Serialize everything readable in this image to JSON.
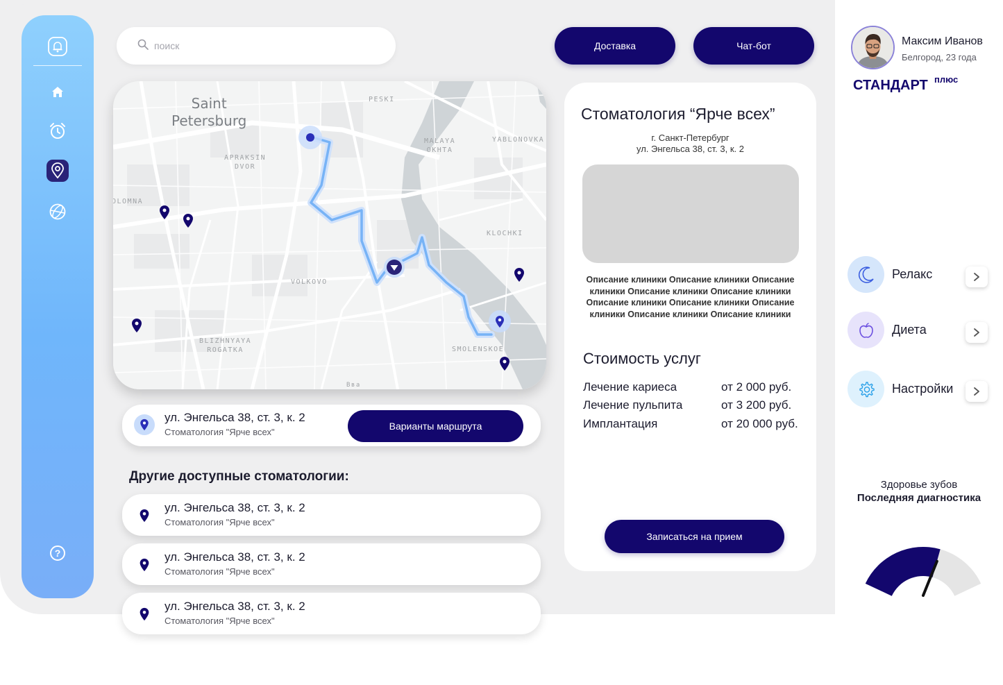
{
  "search": {
    "placeholder": "поиск"
  },
  "header": {
    "delivery_label": "Доставка",
    "chatbot_label": "Чат-бот"
  },
  "sidebar": {
    "items": [
      {
        "name": "bell-icon"
      },
      {
        "name": "home-icon"
      },
      {
        "name": "alarm-clock-icon"
      },
      {
        "name": "map-pin-icon",
        "active": true
      },
      {
        "name": "globe-icon"
      },
      {
        "name": "help-icon"
      }
    ]
  },
  "map": {
    "city": "Saint\nPetersburg",
    "labels": [
      "PESKI",
      "MALAYA\nOKHTA",
      "YABLONOVKA",
      "APRAKSIN\nDVOR",
      "OLOMNA",
      "KLOCHKI",
      "VOLKOVO",
      "BLIZHNYAYA\nROGATKA",
      "SMOLENSKOE",
      "Вва"
    ]
  },
  "selected": {
    "address": "ул. Энгельса 38, ст. 3, к. 2",
    "clinic": "Стоматология \"Ярче всех\"",
    "route_button": "Варианты маршрута"
  },
  "others": {
    "title": "Другие доступные стоматологии:",
    "items": [
      {
        "address": "ул. Энгельса 38, ст. 3, к. 2",
        "clinic": "Стоматология \"Ярче всех\""
      },
      {
        "address": "ул. Энгельса 38, ст. 3, к. 2",
        "clinic": "Стоматология \"Ярче всех\""
      },
      {
        "address": "ул. Энгельса 38, ст. 3, к. 2",
        "clinic": "Стоматология \"Ярче всех\""
      }
    ]
  },
  "clinic": {
    "title": "Стоматология “Ярче всех”",
    "city": "г. Санкт-Петербург",
    "street": "ул. Энгельса 38, ст. 3, к. 2",
    "description": "Описание клиники Описание клиники Описание клиники Описание клиники Описание клиники Описание клиники Описание клиники Описание клиники Описание клиники Описание клиники",
    "prices_title": "Стоимость услуг",
    "prices": [
      {
        "name": "Лечение кариеса",
        "price": "от 2 000 руб."
      },
      {
        "name": "Лечение пульпита",
        "price": "от 3 200 руб."
      },
      {
        "name": "Имплантация",
        "price": "от 20 000 руб."
      }
    ],
    "book_button": "Записаться на прием"
  },
  "user": {
    "name": "Максим Иванов",
    "details": "Белгород, 23 года",
    "plan": "СТАНДАРТ",
    "plan_suffix": "плюс"
  },
  "menu": [
    {
      "label": "Релакс",
      "icon": "moon-icon"
    },
    {
      "label": "Диета",
      "icon": "apple-icon"
    },
    {
      "label": "Настройки",
      "icon": "gear-icon"
    }
  ],
  "health": {
    "title": "Здоровье зубов",
    "subtitle": "Последняя диагностика",
    "level": 0.62
  },
  "colors": {
    "primary": "#13076d",
    "sidebar_top": "#8fd0fd",
    "sidebar_bottom": "#79aef8",
    "route": "#7bb4f7",
    "background": "#efeff0"
  }
}
